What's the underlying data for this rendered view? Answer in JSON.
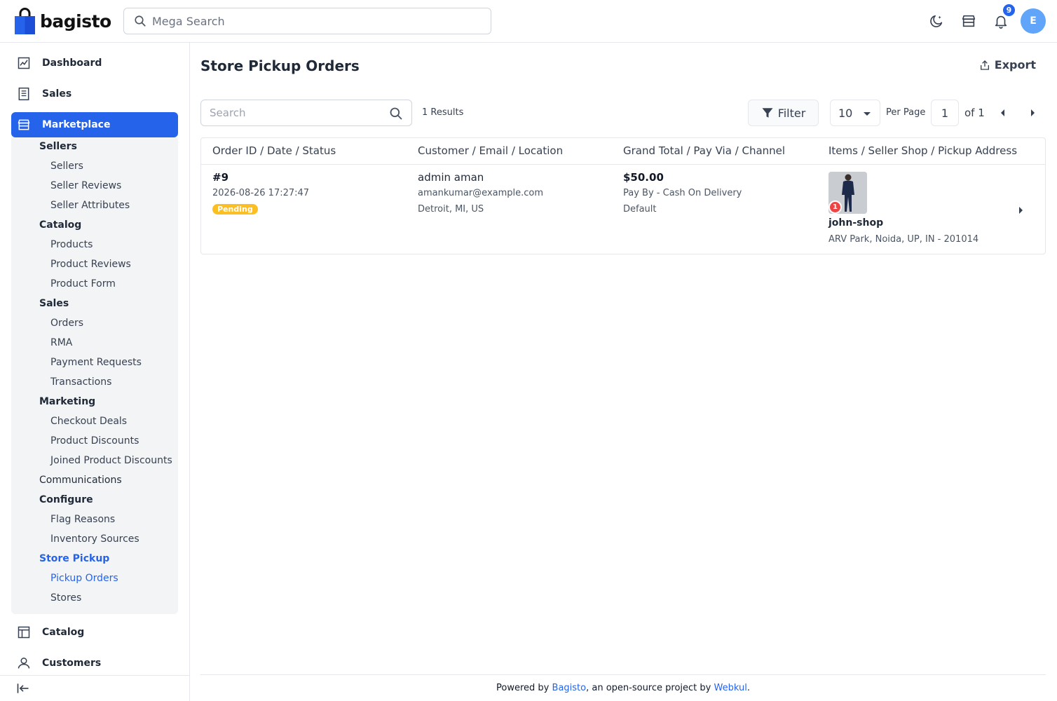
{
  "app": {
    "brand": "bagisto",
    "brand_color": "#2563eb"
  },
  "topbar": {
    "search_placeholder": "Mega Search",
    "notification_count": "9",
    "avatar_initial": "E"
  },
  "sidebar": {
    "items": [
      {
        "label": "Dashboard",
        "icon": "dashboard-icon"
      },
      {
        "label": "Sales",
        "icon": "sales-icon"
      },
      {
        "label": "Marketplace",
        "icon": "store-icon"
      },
      {
        "label": "Catalog",
        "icon": "catalog-icon"
      },
      {
        "label": "Customers",
        "icon": "customers-icon"
      }
    ],
    "marketplace_submenu": [
      {
        "label": "Sellers",
        "type": "group"
      },
      {
        "label": "Sellers",
        "type": "leaf"
      },
      {
        "label": "Seller Reviews",
        "type": "leaf"
      },
      {
        "label": "Seller Attributes",
        "type": "leaf"
      },
      {
        "label": "Catalog",
        "type": "group"
      },
      {
        "label": "Products",
        "type": "leaf"
      },
      {
        "label": "Product Reviews",
        "type": "leaf"
      },
      {
        "label": "Product Form",
        "type": "leaf"
      },
      {
        "label": "Sales",
        "type": "group"
      },
      {
        "label": "Orders",
        "type": "leaf"
      },
      {
        "label": "RMA",
        "type": "leaf"
      },
      {
        "label": "Payment Requests",
        "type": "leaf"
      },
      {
        "label": "Transactions",
        "type": "leaf"
      },
      {
        "label": "Marketing",
        "type": "group"
      },
      {
        "label": "Checkout Deals",
        "type": "leaf"
      },
      {
        "label": "Product Discounts",
        "type": "leaf"
      },
      {
        "label": "Joined Product Discounts",
        "type": "leaf"
      },
      {
        "label": "Communications",
        "type": "single"
      },
      {
        "label": "Configure",
        "type": "group"
      },
      {
        "label": "Flag Reasons",
        "type": "leaf"
      },
      {
        "label": "Inventory Sources",
        "type": "leaf"
      },
      {
        "label": "Store Pickup",
        "type": "group",
        "active": true
      },
      {
        "label": "Pickup Orders",
        "type": "leaf",
        "active": true
      },
      {
        "label": "Stores",
        "type": "leaf"
      }
    ]
  },
  "main": {
    "title": "Store Pickup Orders",
    "export_label": "Export",
    "search_placeholder": "Search",
    "results_text": "1 Results",
    "filter_label": "Filter",
    "per_page_value": "10",
    "per_page_label": "Per Page",
    "current_page": "1",
    "page_of": "of 1",
    "columns": [
      "Order ID / Date / Status",
      "Customer / Email / Location",
      "Grand Total / Pay Via / Channel",
      "Items / Seller Shop / Pickup Address"
    ],
    "rows": [
      {
        "order_id": "#9",
        "date": "2026-08-26 17:27:47",
        "status": "Pending",
        "status_color": "#fbbf24",
        "customer": "admin aman",
        "email": "amankumar@example.com",
        "location": "Detroit, MI, US",
        "grand_total": "$50.00",
        "pay_via": "Pay By - Cash On Delivery",
        "channel": "Default",
        "item_qty": "1",
        "seller_shop": "john-shop",
        "pickup_address": "ARV Park, Noida, UP, IN - 201014"
      }
    ]
  },
  "footer": {
    "prefix": "Powered by ",
    "bagisto_link": "Bagisto",
    "middle": ", an open-source project by ",
    "webkul_link": "Webkul",
    "suffix": "."
  }
}
